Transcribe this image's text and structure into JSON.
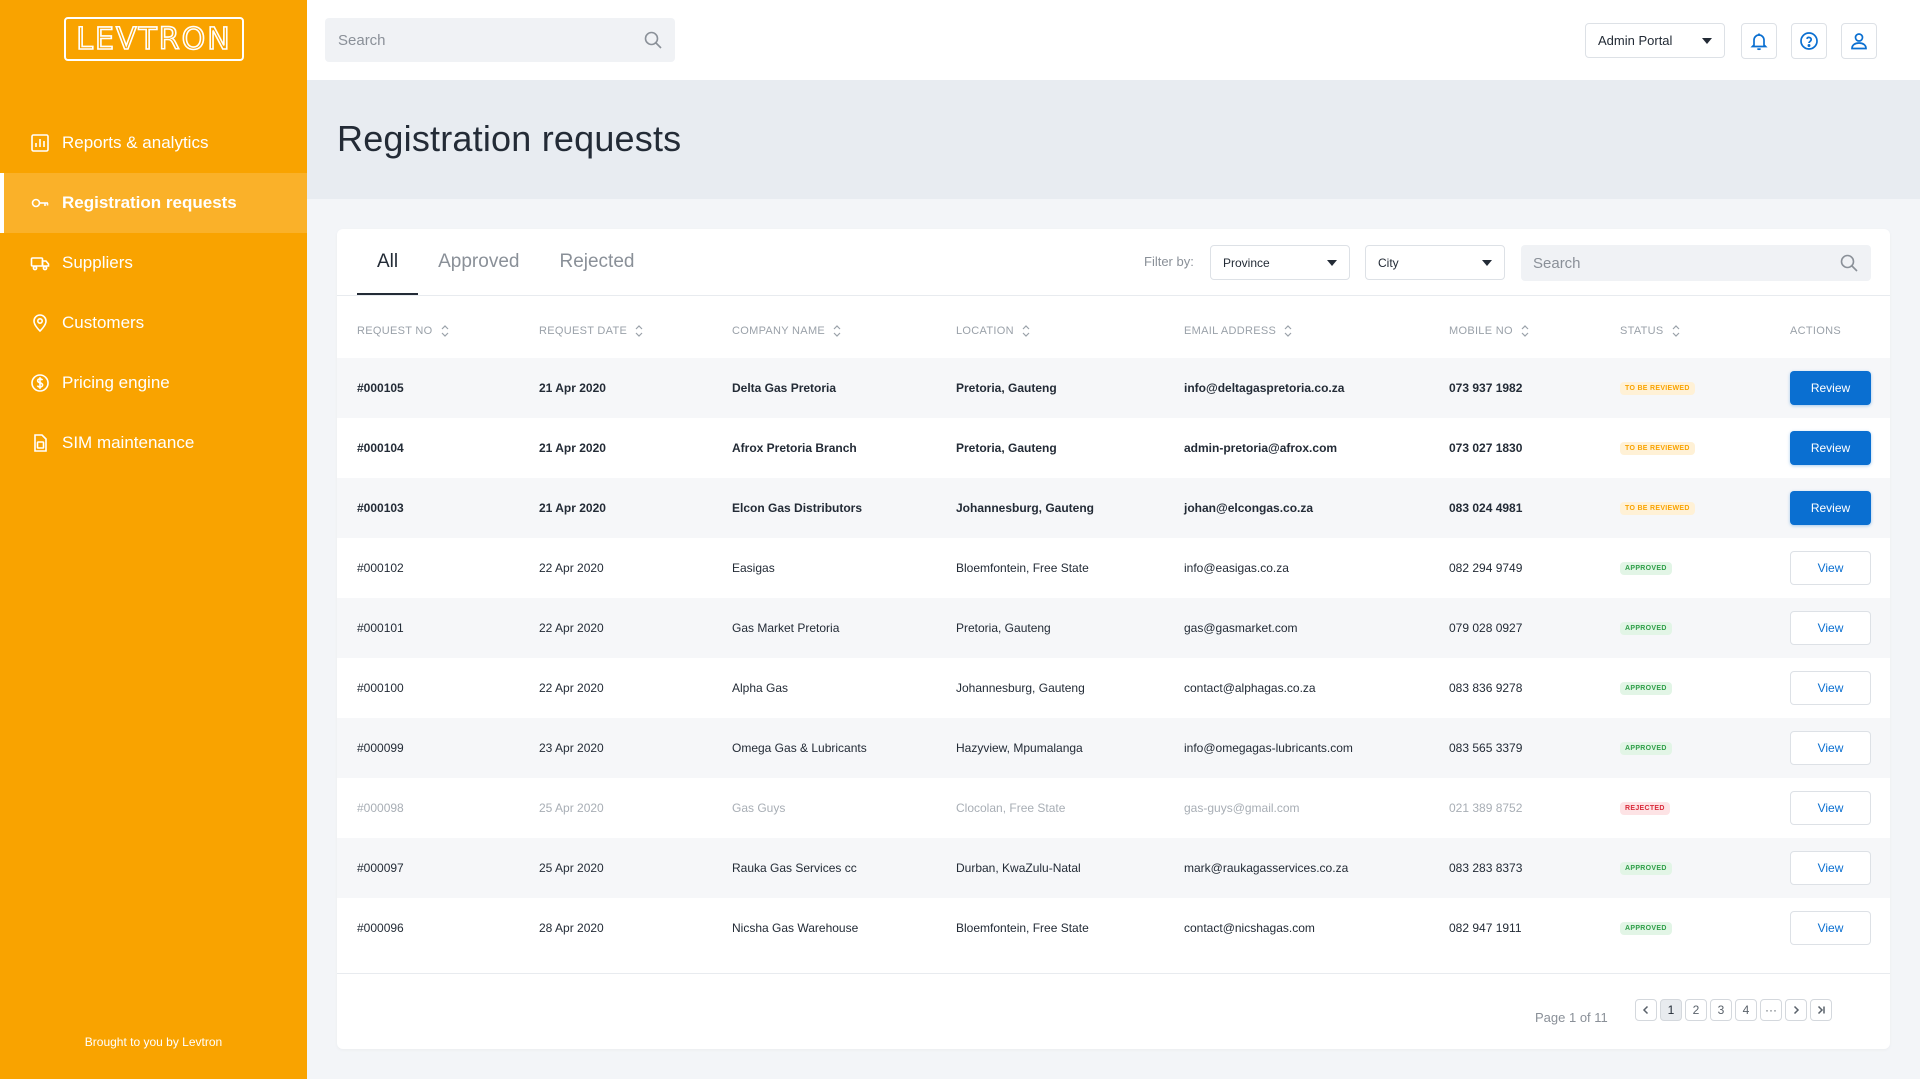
{
  "brand": {
    "logo_text": "LEVTRON"
  },
  "sidebar": {
    "items": [
      {
        "label": "Reports & analytics",
        "icon": "chart-icon",
        "active": false
      },
      {
        "label": "Registration requests",
        "icon": "key-icon",
        "active": true
      },
      {
        "label": "Suppliers",
        "icon": "truck-icon",
        "active": false
      },
      {
        "label": "Customers",
        "icon": "location-pin-icon",
        "active": false
      },
      {
        "label": "Pricing engine",
        "icon": "dollar-icon",
        "active": false
      },
      {
        "label": "SIM maintenance",
        "icon": "sim-card-icon",
        "active": false
      }
    ],
    "footer": "Brought to you by Levtron"
  },
  "topbar": {
    "search_placeholder": "Search",
    "portal": "Admin Portal"
  },
  "page": {
    "title": "Registration requests"
  },
  "tabs": [
    {
      "label": "All",
      "active": true
    },
    {
      "label": "Approved",
      "active": false
    },
    {
      "label": "Rejected",
      "active": false
    }
  ],
  "filters": {
    "label": "Filter by:",
    "province": "Province",
    "city": "City",
    "search_placeholder": "Search"
  },
  "table": {
    "columns": [
      "REQUEST NO",
      "REQUEST DATE",
      "COMPANY NAME",
      "LOCATION",
      "EMAIL ADDRESS",
      "MOBILE NO",
      "STATUS",
      "ACTIONS"
    ],
    "rows": [
      {
        "id": "#000105",
        "date": "21 Apr 2020",
        "company": "Delta Gas Pretoria",
        "location": "Pretoria, Gauteng",
        "email": "info@deltagaspretoria.co.za",
        "mobile": "073 937 1982",
        "status": "TO BE REVIEWED",
        "status_type": "review",
        "action": "Review"
      },
      {
        "id": "#000104",
        "date": "21 Apr 2020",
        "company": "Afrox Pretoria Branch",
        "location": "Pretoria, Gauteng",
        "email": "admin-pretoria@afrox.com",
        "mobile": "073 027 1830",
        "status": "TO BE REVIEWED",
        "status_type": "review",
        "action": "Review"
      },
      {
        "id": "#000103",
        "date": "21 Apr 2020",
        "company": "Elcon Gas Distributors",
        "location": "Johannesburg, Gauteng",
        "email": "johan@elcongas.co.za",
        "mobile": "083 024 4981",
        "status": "TO BE REVIEWED",
        "status_type": "review",
        "action": "Review"
      },
      {
        "id": "#000102",
        "date": "22 Apr 2020",
        "company": "Easigas",
        "location": "Bloemfontein, Free State",
        "email": "info@easigas.co.za",
        "mobile": "082 294 9749",
        "status": "APPROVED",
        "status_type": "approved",
        "action": "View"
      },
      {
        "id": "#000101",
        "date": "22 Apr 2020",
        "company": "Gas Market Pretoria",
        "location": "Pretoria, Gauteng",
        "email": "gas@gasmarket.com",
        "mobile": "079 028 0927",
        "status": "APPROVED",
        "status_type": "approved",
        "action": "View"
      },
      {
        "id": "#000100",
        "date": "22 Apr 2020",
        "company": "Alpha Gas",
        "location": "Johannesburg, Gauteng",
        "email": "contact@alphagas.co.za",
        "mobile": "083 836 9278",
        "status": "APPROVED",
        "status_type": "approved",
        "action": "View"
      },
      {
        "id": "#000099",
        "date": "23 Apr 2020",
        "company": "Omega Gas & Lubricants",
        "location": "Hazyview, Mpumalanga",
        "email": "info@omegagas-lubricants.com",
        "mobile": "083 565 3379",
        "status": "APPROVED",
        "status_type": "approved",
        "action": "View"
      },
      {
        "id": "#000098",
        "date": "25 Apr 2020",
        "company": "Gas Guys",
        "location": "Clocolan, Free State",
        "email": "gas-guys@gmail.com",
        "mobile": "021 389 8752",
        "status": "REJECTED",
        "status_type": "rejected",
        "action": "View"
      },
      {
        "id": "#000097",
        "date": "25 Apr 2020",
        "company": "Rauka Gas Services cc",
        "location": "Durban, KwaZulu-Natal",
        "email": "mark@raukagasservices.co.za",
        "mobile": "083 283 8373",
        "status": "APPROVED",
        "status_type": "approved",
        "action": "View"
      },
      {
        "id": "#000096",
        "date": "28 Apr 2020",
        "company": "Nicsha Gas Warehouse",
        "location": "Bloemfontein, Free State",
        "email": "contact@nicshagas.com",
        "mobile": "082 947 1911",
        "status": "APPROVED",
        "status_type": "approved",
        "action": "View"
      }
    ]
  },
  "pagination": {
    "info": "Page 1 of 11",
    "pages": [
      "1",
      "2",
      "3",
      "4"
    ],
    "current": "1",
    "ellipsis": "···"
  },
  "colors": {
    "sidebar": "#f9a300",
    "primary": "#0a6fd1",
    "review": "#f9a300",
    "approved": "#2e9e48",
    "rejected": "#d92b3a"
  }
}
